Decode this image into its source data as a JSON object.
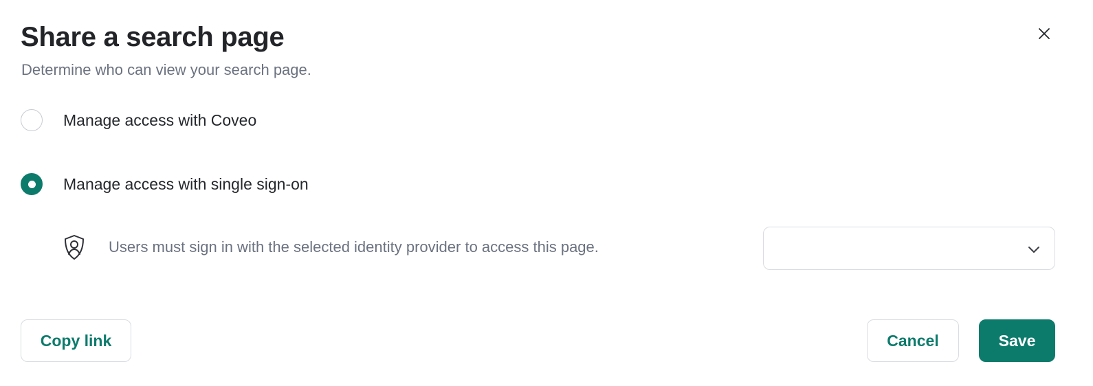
{
  "dialog": {
    "title": "Share a search page",
    "subtitle": "Determine who can view your search page."
  },
  "access_options": [
    {
      "label": "Manage access with Coveo",
      "checked": false
    },
    {
      "label": "Manage access with single sign-on",
      "checked": true
    }
  ],
  "sso": {
    "description": "Users must sign in with the selected identity provider to access this page.",
    "icon": "shield-user-icon",
    "selected_provider": ""
  },
  "footer": {
    "copy_link_label": "Copy link",
    "cancel_label": "Cancel",
    "save_label": "Save"
  },
  "colors": {
    "accent": "#0d7b6c",
    "muted_text": "#6b7280",
    "border": "#d9dce1"
  }
}
